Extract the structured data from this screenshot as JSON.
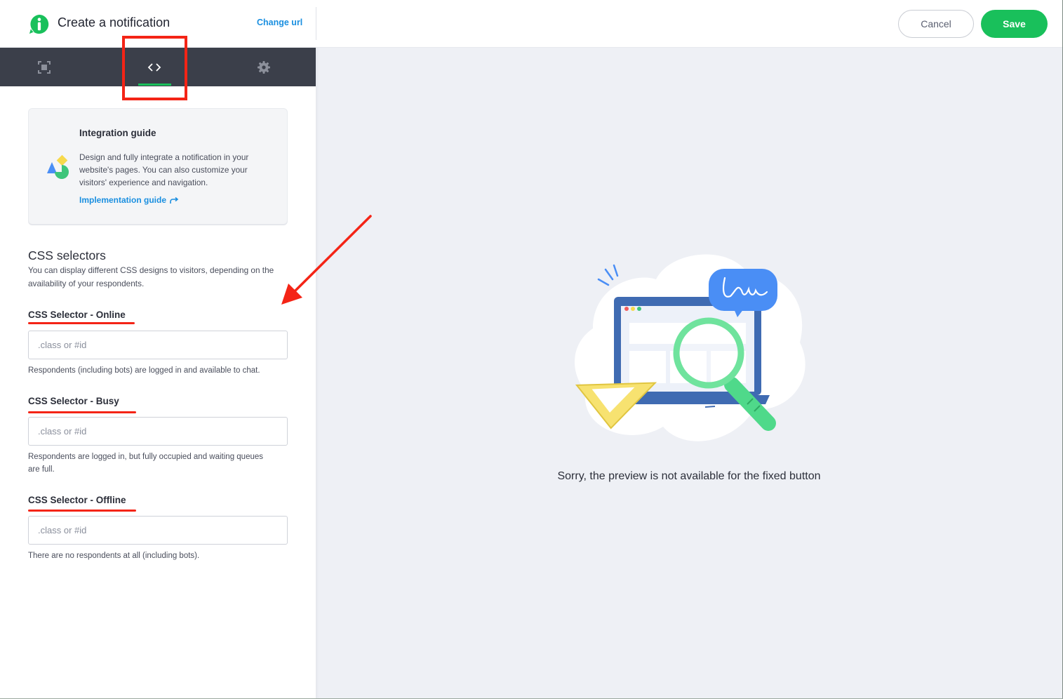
{
  "header": {
    "title": "Create a notification",
    "change_url": "Change url",
    "cancel_label": "Cancel",
    "save_label": "Save"
  },
  "tabs": [
    {
      "name": "layout",
      "icon": "frame-icon",
      "active": false
    },
    {
      "name": "code",
      "icon": "code-icon",
      "active": true
    },
    {
      "name": "settings",
      "icon": "gear-icon",
      "active": false
    }
  ],
  "guide": {
    "title": "Integration guide",
    "description": "Design and fully integrate a notification in your website's pages. You can also customize your visitors' experience and navigation.",
    "link_label": "Implementation guide",
    "link_icon": "external-arrow-icon"
  },
  "css_selectors": {
    "title": "CSS selectors",
    "description": "You can display different CSS designs to visitors, depending on the availability of your respondents.",
    "fields": [
      {
        "label": "CSS Selector - Online",
        "placeholder": ".class or #id",
        "value": "",
        "help": "Respondents (including bots) are logged in and available to chat."
      },
      {
        "label": "CSS Selector - Busy",
        "placeholder": ".class or #id",
        "value": "",
        "help": "Respondents are logged in, but fully occupied and waiting queues are full."
      },
      {
        "label": "CSS Selector - Offline",
        "placeholder": ".class or #id",
        "value": "",
        "help": "There are no respondents at all (including bots)."
      }
    ]
  },
  "preview": {
    "message": "Sorry, the preview is not available for the fixed button",
    "illustration": "laptop-magnifier-illustration"
  },
  "colors": {
    "accent_green": "#19c05b",
    "link_blue": "#1a8fe0",
    "tabbar_bg": "#3b3f4a",
    "annotation_red": "#f42416",
    "preview_bg": "#eef0f5"
  }
}
